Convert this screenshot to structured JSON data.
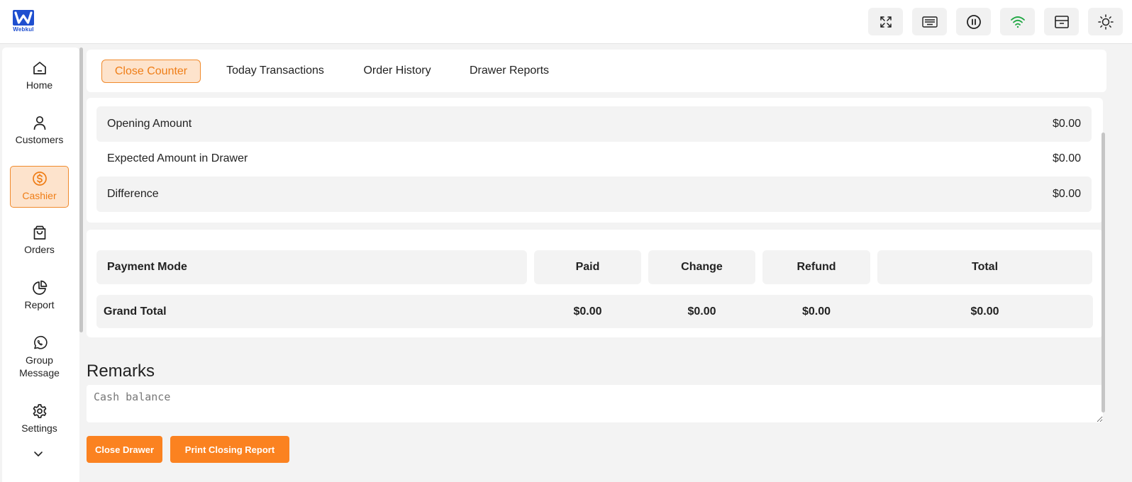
{
  "brand": {
    "logo_text": "Webkul",
    "primary_color": "#1f4fcf",
    "accent_color": "#fb8220"
  },
  "topbar": {
    "buttons": [
      {
        "icon": "fullscreen-icon"
      },
      {
        "icon": "keyboard-icon"
      },
      {
        "icon": "pause-icon"
      },
      {
        "icon": "wifi-icon",
        "status_color": "#22a845"
      },
      {
        "icon": "drawer-icon"
      },
      {
        "icon": "theme-sun-icon"
      }
    ]
  },
  "sidebar": {
    "items": [
      {
        "label": "Home",
        "icon": "home-icon"
      },
      {
        "label": "Customers",
        "icon": "user-icon"
      },
      {
        "label": "Cashier",
        "icon": "dollar-coin-icon",
        "active": true
      },
      {
        "label": "Orders",
        "icon": "shopping-bag-icon"
      },
      {
        "label": "Report",
        "icon": "pie-chart-icon"
      },
      {
        "label": "Group Message",
        "icon": "whatsapp-icon"
      },
      {
        "label": "Settings",
        "icon": "gear-icon"
      }
    ],
    "more_icon": "chevron-down-icon"
  },
  "tabs": [
    {
      "label": "Close Counter",
      "active": true
    },
    {
      "label": "Today Transactions"
    },
    {
      "label": "Order History"
    },
    {
      "label": "Drawer Reports"
    }
  ],
  "summary": [
    {
      "label": "Opening Amount",
      "value": "$0.00"
    },
    {
      "label": "Expected Amount in Drawer",
      "value": "$0.00"
    },
    {
      "label": "Difference",
      "value": "$0.00"
    }
  ],
  "payments": {
    "headers": [
      "Payment Mode",
      "Paid",
      "Change",
      "Refund",
      "Total"
    ],
    "grand_total": {
      "label": "Grand Total",
      "paid": "$0.00",
      "change": "$0.00",
      "refund": "$0.00",
      "total": "$0.00"
    }
  },
  "remarks": {
    "title": "Remarks",
    "placeholder": "Cash balance",
    "value": ""
  },
  "actions": {
    "close_drawer": "Close Drawer",
    "print_report": "Print Closing Report"
  }
}
